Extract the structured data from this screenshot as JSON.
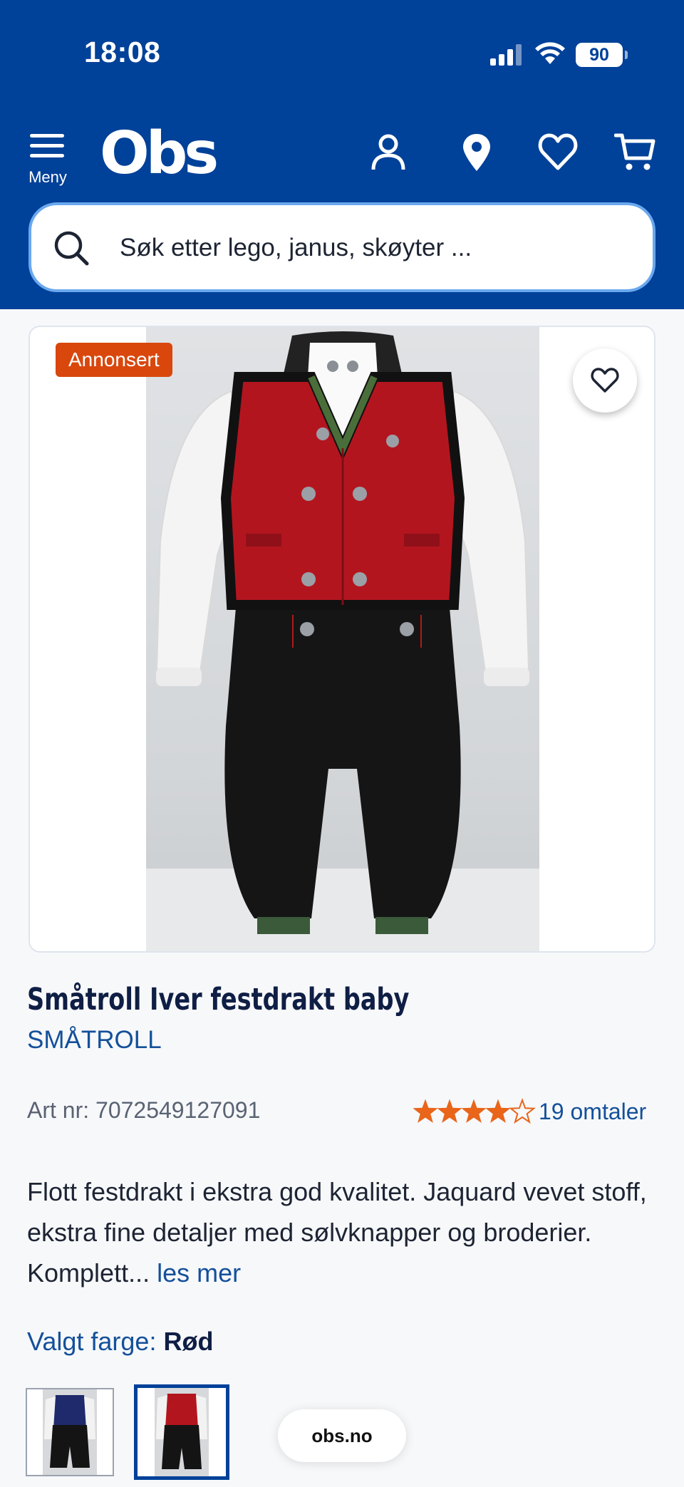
{
  "status": {
    "time": "18:08",
    "battery": "90"
  },
  "header": {
    "menu_label": "Meny",
    "logo_text": "Obs",
    "icons": [
      "user-icon",
      "location-pin-icon",
      "heart-icon",
      "cart-icon"
    ],
    "accent": "#004199"
  },
  "search": {
    "placeholder": "Søk etter lego, janus, skøyter ..."
  },
  "product": {
    "badge": "Annonsert",
    "title": "Småtroll Iver festdrakt baby",
    "brand": "SMÅTROLL",
    "art_nr": "Art nr: 7072549127091",
    "rating": 4,
    "rating_max": 5,
    "reviews": "19 omtaler",
    "description": "Flott festdrakt i ekstra god kvalitet. Jaquard vevet stoff, ekstra fine detaljer med sølvknapper og broderier. Komplett...",
    "read_more": "les mer",
    "color_label": "Valgt farge:",
    "color_value": "Rød",
    "variants": [
      "Blå",
      "Rød"
    ],
    "selected_variant": 1
  },
  "browser": {
    "domain": "obs.no"
  }
}
